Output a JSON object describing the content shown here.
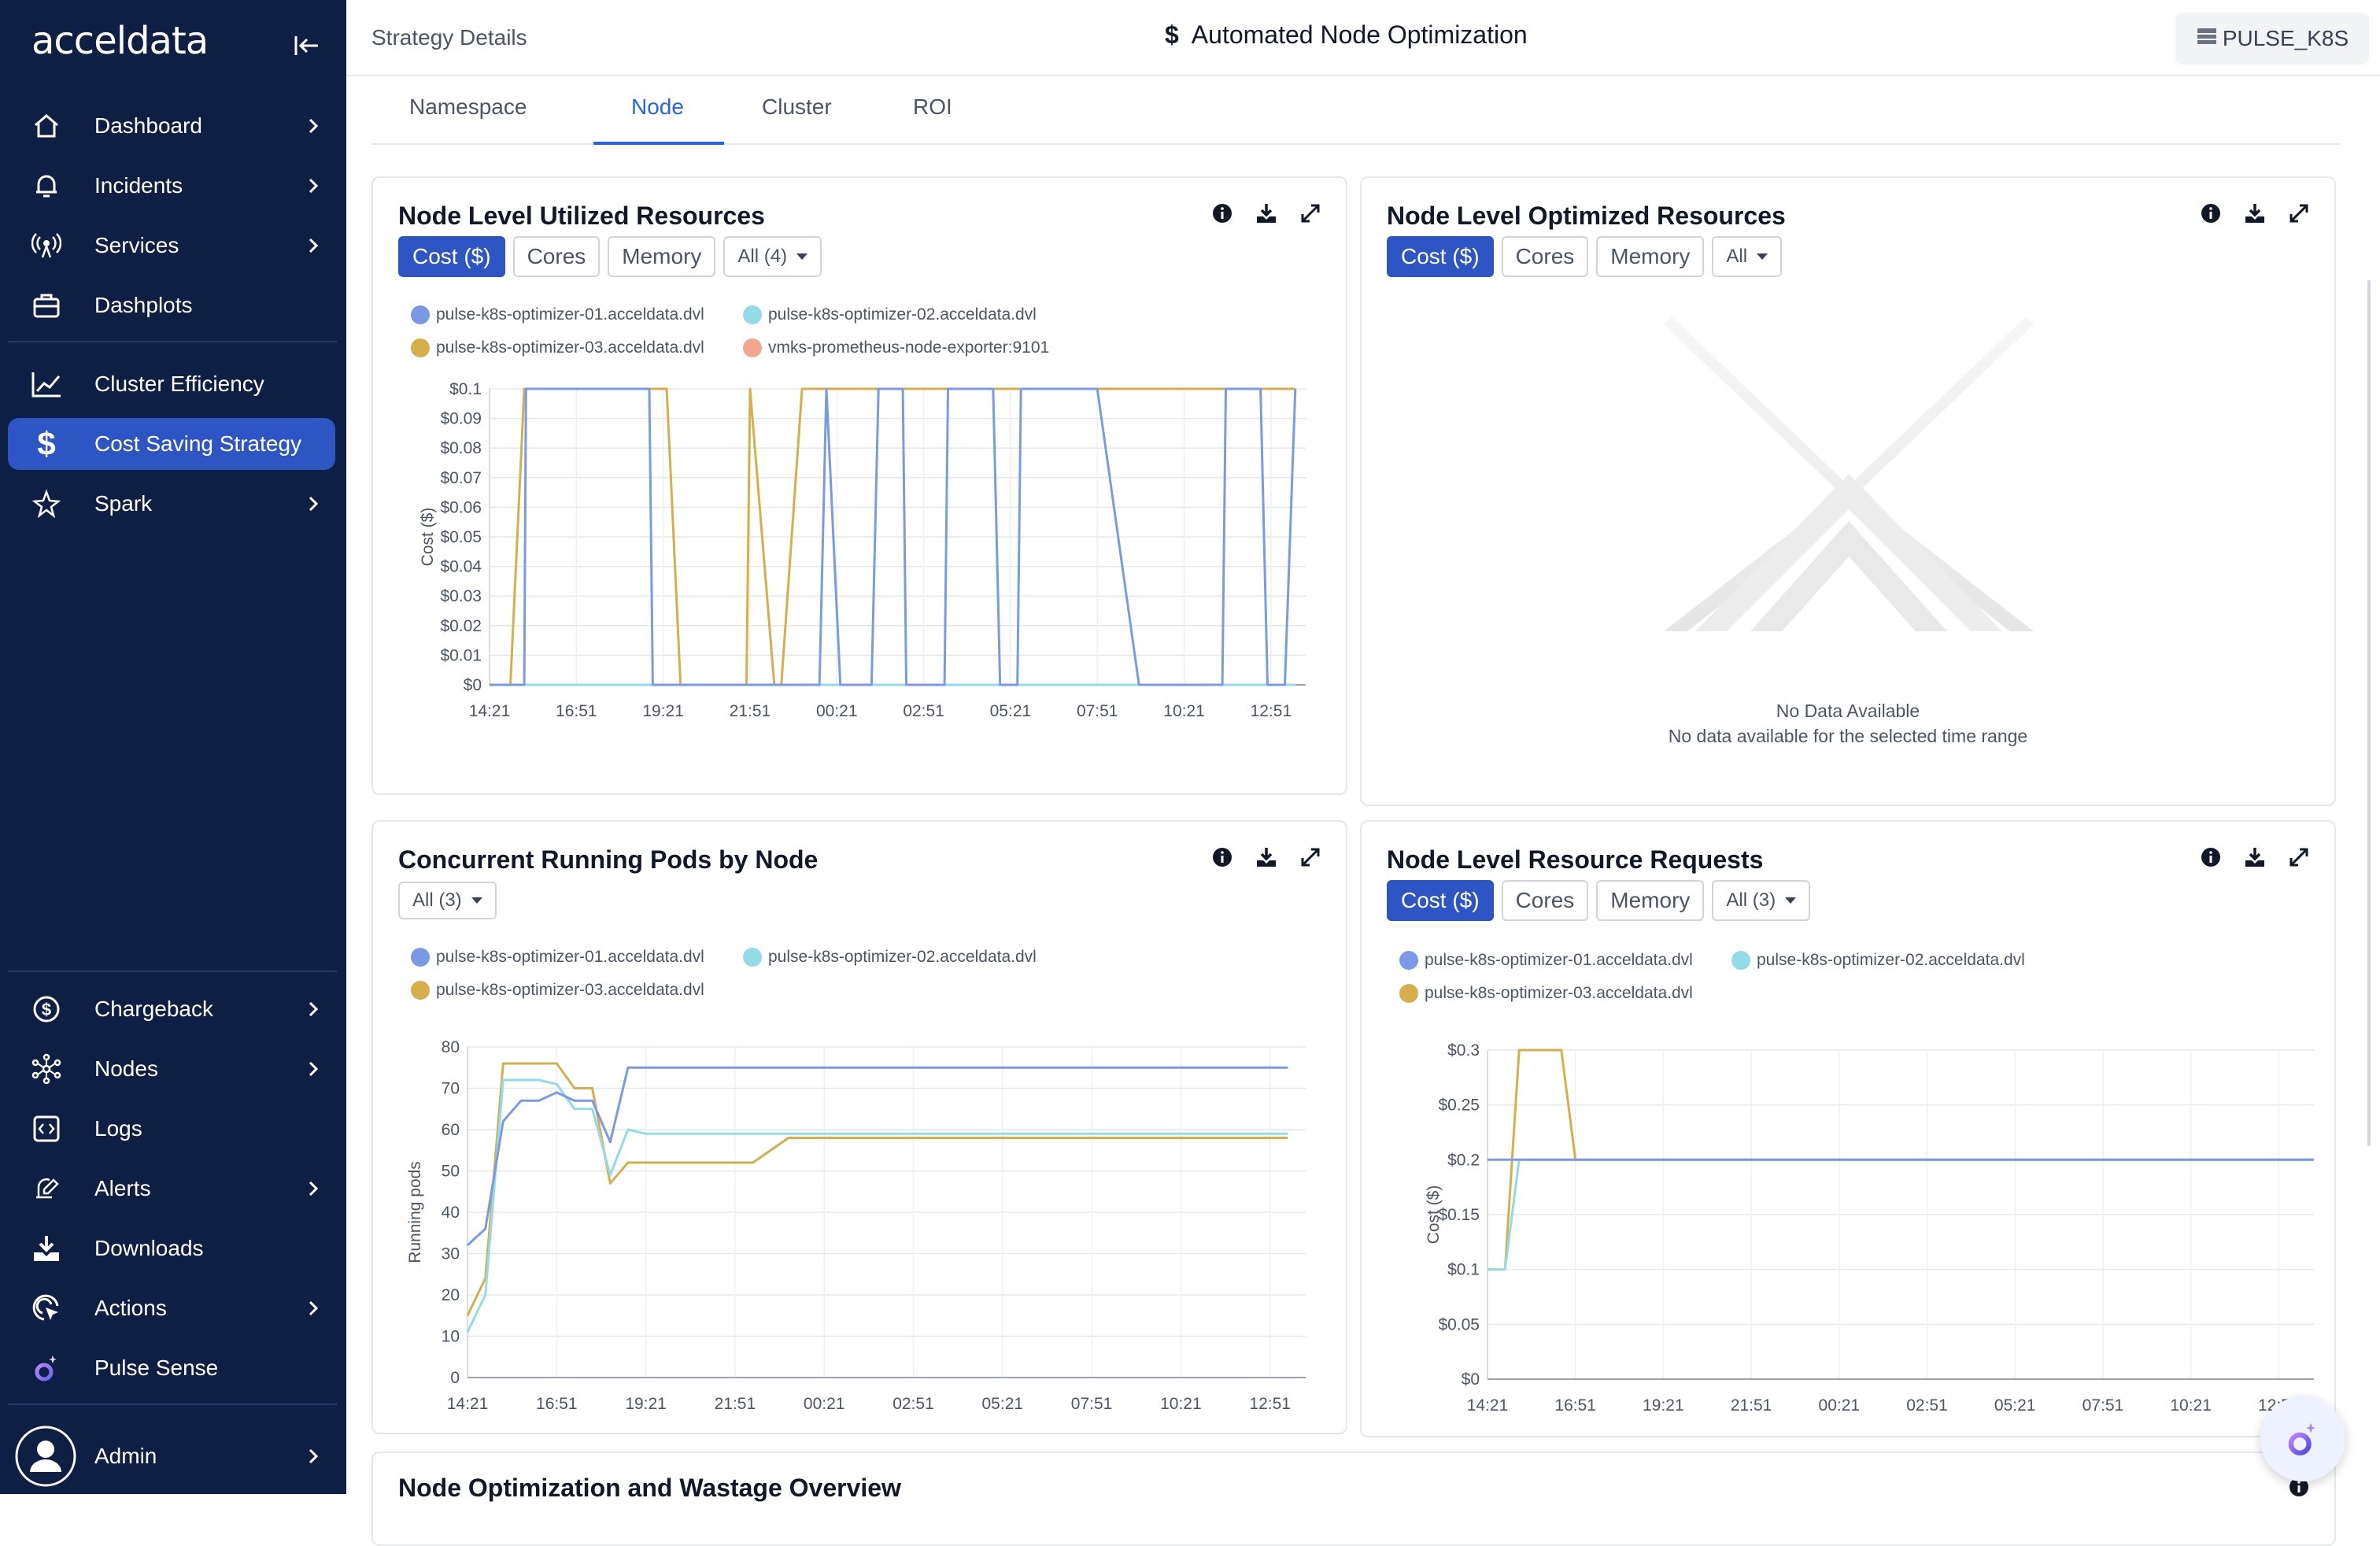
{
  "brand": {
    "logo_text": "acceldata"
  },
  "sidebar": {
    "items": [
      {
        "label": "Dashboard",
        "icon": "home-icon"
      },
      {
        "label": "Incidents",
        "icon": "bell-icon"
      },
      {
        "label": "Services",
        "icon": "broadcast-icon"
      },
      {
        "label": "Dashplots",
        "icon": "briefcase-icon"
      },
      {
        "label": "Cluster Efficiency",
        "icon": "trend-chart-icon"
      },
      {
        "label": "Cost Saving Strategy",
        "icon": "dollar-icon",
        "active": true
      },
      {
        "label": "Spark",
        "icon": "spark-star-icon"
      },
      {
        "label": "Chargeback",
        "icon": "dollar-circle-icon"
      },
      {
        "label": "Nodes",
        "icon": "network-nodes-icon"
      },
      {
        "label": "Logs",
        "icon": "code-brackets-icon"
      },
      {
        "label": "Alerts",
        "icon": "alert-edit-icon"
      },
      {
        "label": "Downloads",
        "icon": "download-tray-icon"
      },
      {
        "label": "Actions",
        "icon": "target-cursor-icon"
      },
      {
        "label": "Pulse Sense",
        "icon": "pulse-sense-icon"
      },
      {
        "label": "Admin",
        "icon": "user-avatar-icon"
      }
    ]
  },
  "header": {
    "breadcrumb": "Strategy Details",
    "title": "Automated Node Optimization",
    "title_icon": "$",
    "environment": "PULSE_K8S"
  },
  "tabs": [
    "Namespace",
    "Node",
    "Cluster",
    "ROI"
  ],
  "active_tab": "Node",
  "cards": {
    "utilized": {
      "title": "Node Level Utilized Resources",
      "pills": [
        "Cost ($)",
        "Cores",
        "Memory"
      ],
      "dropdown": "All (4)"
    },
    "optimized": {
      "title": "Node Level Optimized Resources",
      "pills": [
        "Cost ($)",
        "Cores",
        "Memory"
      ],
      "dropdown": "All",
      "no_data_title": "No Data Available",
      "no_data_text": "No data available for the selected time range"
    },
    "pods": {
      "title": "Concurrent Running Pods by Node",
      "dropdown": "All (3)"
    },
    "requests": {
      "title": "Node Level Resource Requests",
      "pills": [
        "Cost ($)",
        "Cores",
        "Memory"
      ],
      "dropdown": "All (3)"
    },
    "overview": {
      "title": "Node Optimization and Wastage Overview"
    }
  },
  "colors": {
    "node01": "#7b9ae6",
    "node02": "#93dbe6",
    "node03": "#d6ae4c",
    "node04": "#f2a88e",
    "accent": "#2d56c4",
    "sidebar": "#0e1f44"
  },
  "chart_data": [
    {
      "type": "line",
      "title": "Node Level Utilized Resources",
      "ylabel": "Cost ($)",
      "ylim": [
        0,
        0.1
      ],
      "yticks": [
        "$0",
        "$0.01",
        "$0.02",
        "$0.03",
        "$0.04",
        "$0.05",
        "$0.06",
        "$0.07",
        "$0.08",
        "$0.09",
        "$0.1"
      ],
      "categories": [
        "14:21",
        "16:51",
        "19:21",
        "21:51",
        "00:21",
        "02:51",
        "05:21",
        "07:51",
        "10:21",
        "12:51"
      ],
      "x": [
        0,
        0.25,
        0.5,
        0.6,
        1.0,
        1.05,
        1.8,
        1.9,
        3.7,
        3.8,
        4.0,
        4.6,
        4.7,
        5.0,
        5.1,
        5.5,
        5.6,
        6.1,
        6.3,
        6.6,
        6.7,
        7.1,
        7.4,
        7.5,
        8.2,
        8.4,
        9.0,
        9.2,
        9.5,
        9.7,
        10.1,
        10.3,
        11.0,
        11.2,
        11.3,
        11.9,
        12.0,
        12.4,
        12.5,
        13.1,
        13.2,
        13.6,
        13.8,
        14.5,
        14.7,
        15.2,
        15.3,
        16.0,
        16.3,
        16.5,
        17.1,
        17.3,
        17.5,
        18.7,
        19.0,
        19.6,
        19.8,
        20.2,
        20.3,
        21.1,
        21.2,
        22.2,
        22.4,
        22.9,
        23.2
      ],
      "series": [
        {
          "name": "pulse-k8s-optimizer-01.acceldata.dvl",
          "values": [
            0,
            0,
            0,
            0,
            0,
            0.1,
            0.1,
            0.1,
            0.1,
            0.1,
            0.1,
            0.1,
            0,
            0,
            0,
            0,
            0,
            0,
            0,
            0,
            0,
            0,
            0,
            0,
            0,
            0,
            0,
            0,
            0,
            0.1,
            0,
            0,
            0,
            0.1,
            0.1,
            0.1,
            0,
            0,
            0,
            0,
            0.1,
            0.1,
            0.1,
            0.1,
            0,
            0,
            0.1,
            0.1,
            0.1,
            0.1,
            0.1,
            0.1,
            0.1,
            0,
            0,
            0,
            0,
            0,
            0,
            0,
            0.1,
            0.1,
            0,
            0,
            0.1
          ]
        },
        {
          "name": "pulse-k8s-optimizer-02.acceldata.dvl",
          "values": [
            0,
            0,
            0,
            0,
            0,
            0,
            0,
            0,
            0,
            0,
            0,
            0,
            0,
            0,
            0,
            0,
            0,
            0,
            0,
            0,
            0,
            0,
            0,
            0,
            0,
            0,
            0,
            0,
            0,
            0,
            0,
            0,
            0,
            0,
            0,
            0,
            0,
            0,
            0,
            0,
            0,
            0,
            0,
            0,
            0,
            0,
            0,
            0,
            0,
            0,
            0,
            0,
            0,
            0,
            0,
            0,
            0,
            0,
            0,
            0,
            0,
            0,
            0,
            0,
            0
          ]
        },
        {
          "name": "pulse-k8s-optimizer-03.acceldata.dvl",
          "values": [
            0,
            0,
            0,
            0,
            0.1,
            0.1,
            0.1,
            0.1,
            0.1,
            0.1,
            0.1,
            0.1,
            0.1,
            0.1,
            0.1,
            0,
            0,
            0,
            0,
            0,
            0,
            0,
            0,
            0.1,
            0,
            0,
            0.1,
            0.1,
            0.1,
            0.1,
            0.1,
            0.1,
            0.1,
            0.1,
            0.1,
            0.1,
            0.1,
            0.1,
            0.1,
            0.1,
            0.1,
            0.1,
            0.1,
            0.1,
            0.1,
            0.1,
            0.1,
            0.1,
            0.1,
            0.1,
            0.1,
            0.1,
            0.1,
            0.1,
            0.1,
            0.1,
            0.1,
            0.1,
            0.1,
            0.1,
            0.1,
            0.1,
            0.1,
            0.1,
            0.1
          ]
        },
        {
          "name": "vmks-prometheus-node-exporter:9101",
          "values": []
        }
      ]
    },
    {
      "type": "line",
      "title": "Concurrent Running Pods by Node",
      "ylabel": "Running pods",
      "ylim": [
        0,
        80
      ],
      "yticks": [
        "0",
        "10",
        "20",
        "30",
        "40",
        "50",
        "60",
        "70",
        "80"
      ],
      "categories": [
        "14:21",
        "16:51",
        "19:21",
        "21:51",
        "00:21",
        "02:51",
        "05:21",
        "07:51",
        "10:21",
        "12:51"
      ],
      "x": [
        0,
        0.5,
        1,
        1.5,
        2,
        2.5,
        3,
        3.5,
        4,
        4.5,
        5,
        6,
        7,
        8,
        9,
        23
      ],
      "series": [
        {
          "name": "pulse-k8s-optimizer-01.acceldata.dvl",
          "values": [
            32,
            36,
            62,
            67,
            67,
            69,
            67,
            67,
            57,
            75,
            75,
            75,
            75,
            75,
            75,
            75
          ]
        },
        {
          "name": "pulse-k8s-optimizer-02.acceldata.dvl",
          "values": [
            11,
            20,
            72,
            72,
            72,
            71,
            65,
            65,
            49,
            60,
            59,
            59,
            59,
            59,
            59,
            59
          ]
        },
        {
          "name": "pulse-k8s-optimizer-03.acceldata.dvl",
          "values": [
            15,
            24,
            76,
            76,
            76,
            76,
            70,
            70,
            47,
            52,
            52,
            52,
            52,
            52,
            58,
            58
          ]
        }
      ]
    },
    {
      "type": "line",
      "title": "Node Level Resource Requests",
      "ylabel": "Cost ($)",
      "ylim": [
        0,
        0.3
      ],
      "yticks": [
        "$0",
        "$0.05",
        "$0.1",
        "$0.15",
        "$0.2",
        "$0.25",
        "$0.3"
      ],
      "categories": [
        "14:21",
        "16:51",
        "19:21",
        "21:51",
        "00:21",
        "02:51",
        "05:21",
        "07:51",
        "10:21",
        "12:51"
      ],
      "x": [
        0,
        0.5,
        0.9,
        1,
        2.1,
        2.5,
        3,
        23.5
      ],
      "series": [
        {
          "name": "pulse-k8s-optimizer-01.acceldata.dvl",
          "values": [
            0.2,
            0.2,
            0.2,
            0.2,
            0.2,
            0.2,
            0.2,
            0.2
          ]
        },
        {
          "name": "pulse-k8s-optimizer-02.acceldata.dvl",
          "values": [
            0.1,
            0.1,
            0.2,
            0.2,
            0.2,
            0.2,
            0.2,
            0.2
          ]
        },
        {
          "name": "pulse-k8s-optimizer-03.acceldata.dvl",
          "values": [
            0.1,
            0.1,
            0.3,
            0.3,
            0.3,
            0.2,
            0.2,
            0.2
          ]
        }
      ]
    }
  ]
}
